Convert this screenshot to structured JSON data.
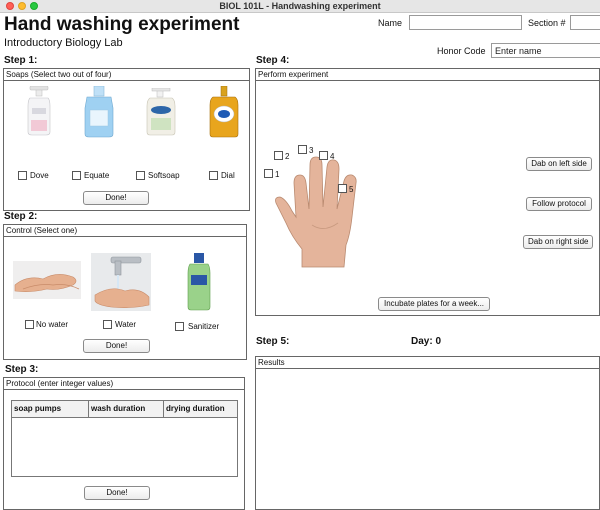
{
  "window": {
    "title": "BIOL 101L - Handwashing experiment"
  },
  "header": {
    "title": "Hand washing experiment",
    "subtitle": "Introductory Biology Lab",
    "name_label": "Name",
    "name_value": "",
    "section_label": "Section #",
    "section_value": "",
    "honor_label": "Honor Code",
    "honor_placeholder": "Enter name"
  },
  "step1": {
    "heading": "Step 1:",
    "panel_title": "Soaps (Select two out of four)",
    "options": [
      {
        "label": "Dove",
        "checked": false
      },
      {
        "label": "Equate",
        "checked": false
      },
      {
        "label": "Softsoap",
        "checked": false
      },
      {
        "label": "Dial",
        "checked": false
      }
    ],
    "done_label": "Done!"
  },
  "step2": {
    "heading": "Step 2:",
    "panel_title": "Control (Select one)",
    "options": [
      {
        "label": "No water",
        "checked": false
      },
      {
        "label": "Water",
        "checked": false
      },
      {
        "label": "Sanitizer",
        "checked": false
      }
    ],
    "done_label": "Done!"
  },
  "step3": {
    "heading": "Step 3:",
    "panel_title": "Protocol (enter integer values)",
    "columns": [
      "soap pumps",
      "wash duration",
      "drying duration"
    ],
    "done_label": "Done!"
  },
  "step4": {
    "heading": "Step 4:",
    "panel_title": "Perform experiment",
    "finger_labels": [
      "1",
      "2",
      "3",
      "4",
      "5"
    ],
    "dab_left_label": "Dab on left side",
    "follow_protocol_label": "Follow protocol",
    "dab_right_label": "Dab on right side",
    "incubate_label": "Incubate plates for a week..."
  },
  "step5": {
    "heading": "Step 5:",
    "day_label": "Day: 0",
    "results_title": "Results"
  }
}
